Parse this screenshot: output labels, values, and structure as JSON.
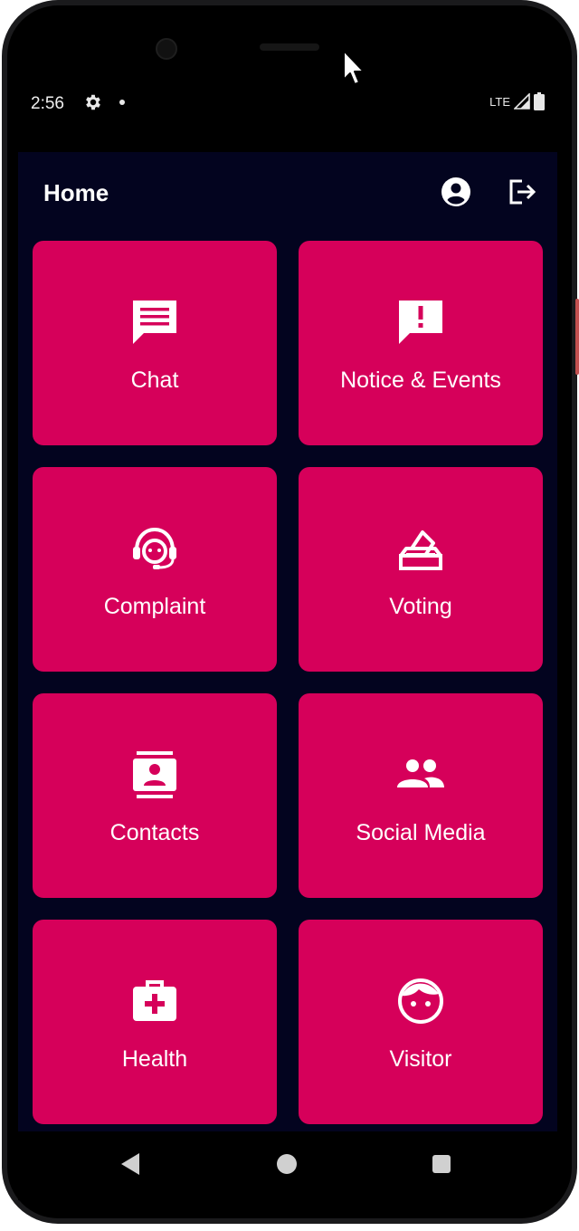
{
  "status_bar": {
    "time": "2:56",
    "network": "LTE",
    "settings_icon": "gear-icon",
    "signal_icon": "signal-icon",
    "battery_icon": "battery-icon"
  },
  "app_bar": {
    "title": "Home",
    "profile_icon": "account-circle-icon",
    "logout_icon": "logout-icon"
  },
  "tiles": [
    {
      "label": "Chat",
      "icon": "chat-icon"
    },
    {
      "label": "Notice & Events",
      "icon": "announcement-icon"
    },
    {
      "label": "Complaint",
      "icon": "support-agent-icon"
    },
    {
      "label": "Voting",
      "icon": "ballot-box-icon"
    },
    {
      "label": "Contacts",
      "icon": "contacts-icon"
    },
    {
      "label": "Social Media",
      "icon": "people-icon"
    },
    {
      "label": "Health",
      "icon": "medical-kit-icon"
    },
    {
      "label": "Visitor",
      "icon": "face-icon"
    }
  ],
  "colors": {
    "background": "#03041f",
    "tile": "#d6005a",
    "text": "#ffffff"
  },
  "nav_bar": {
    "back_icon": "back-triangle-icon",
    "home_icon": "home-circle-icon",
    "recents_icon": "recents-square-icon"
  }
}
